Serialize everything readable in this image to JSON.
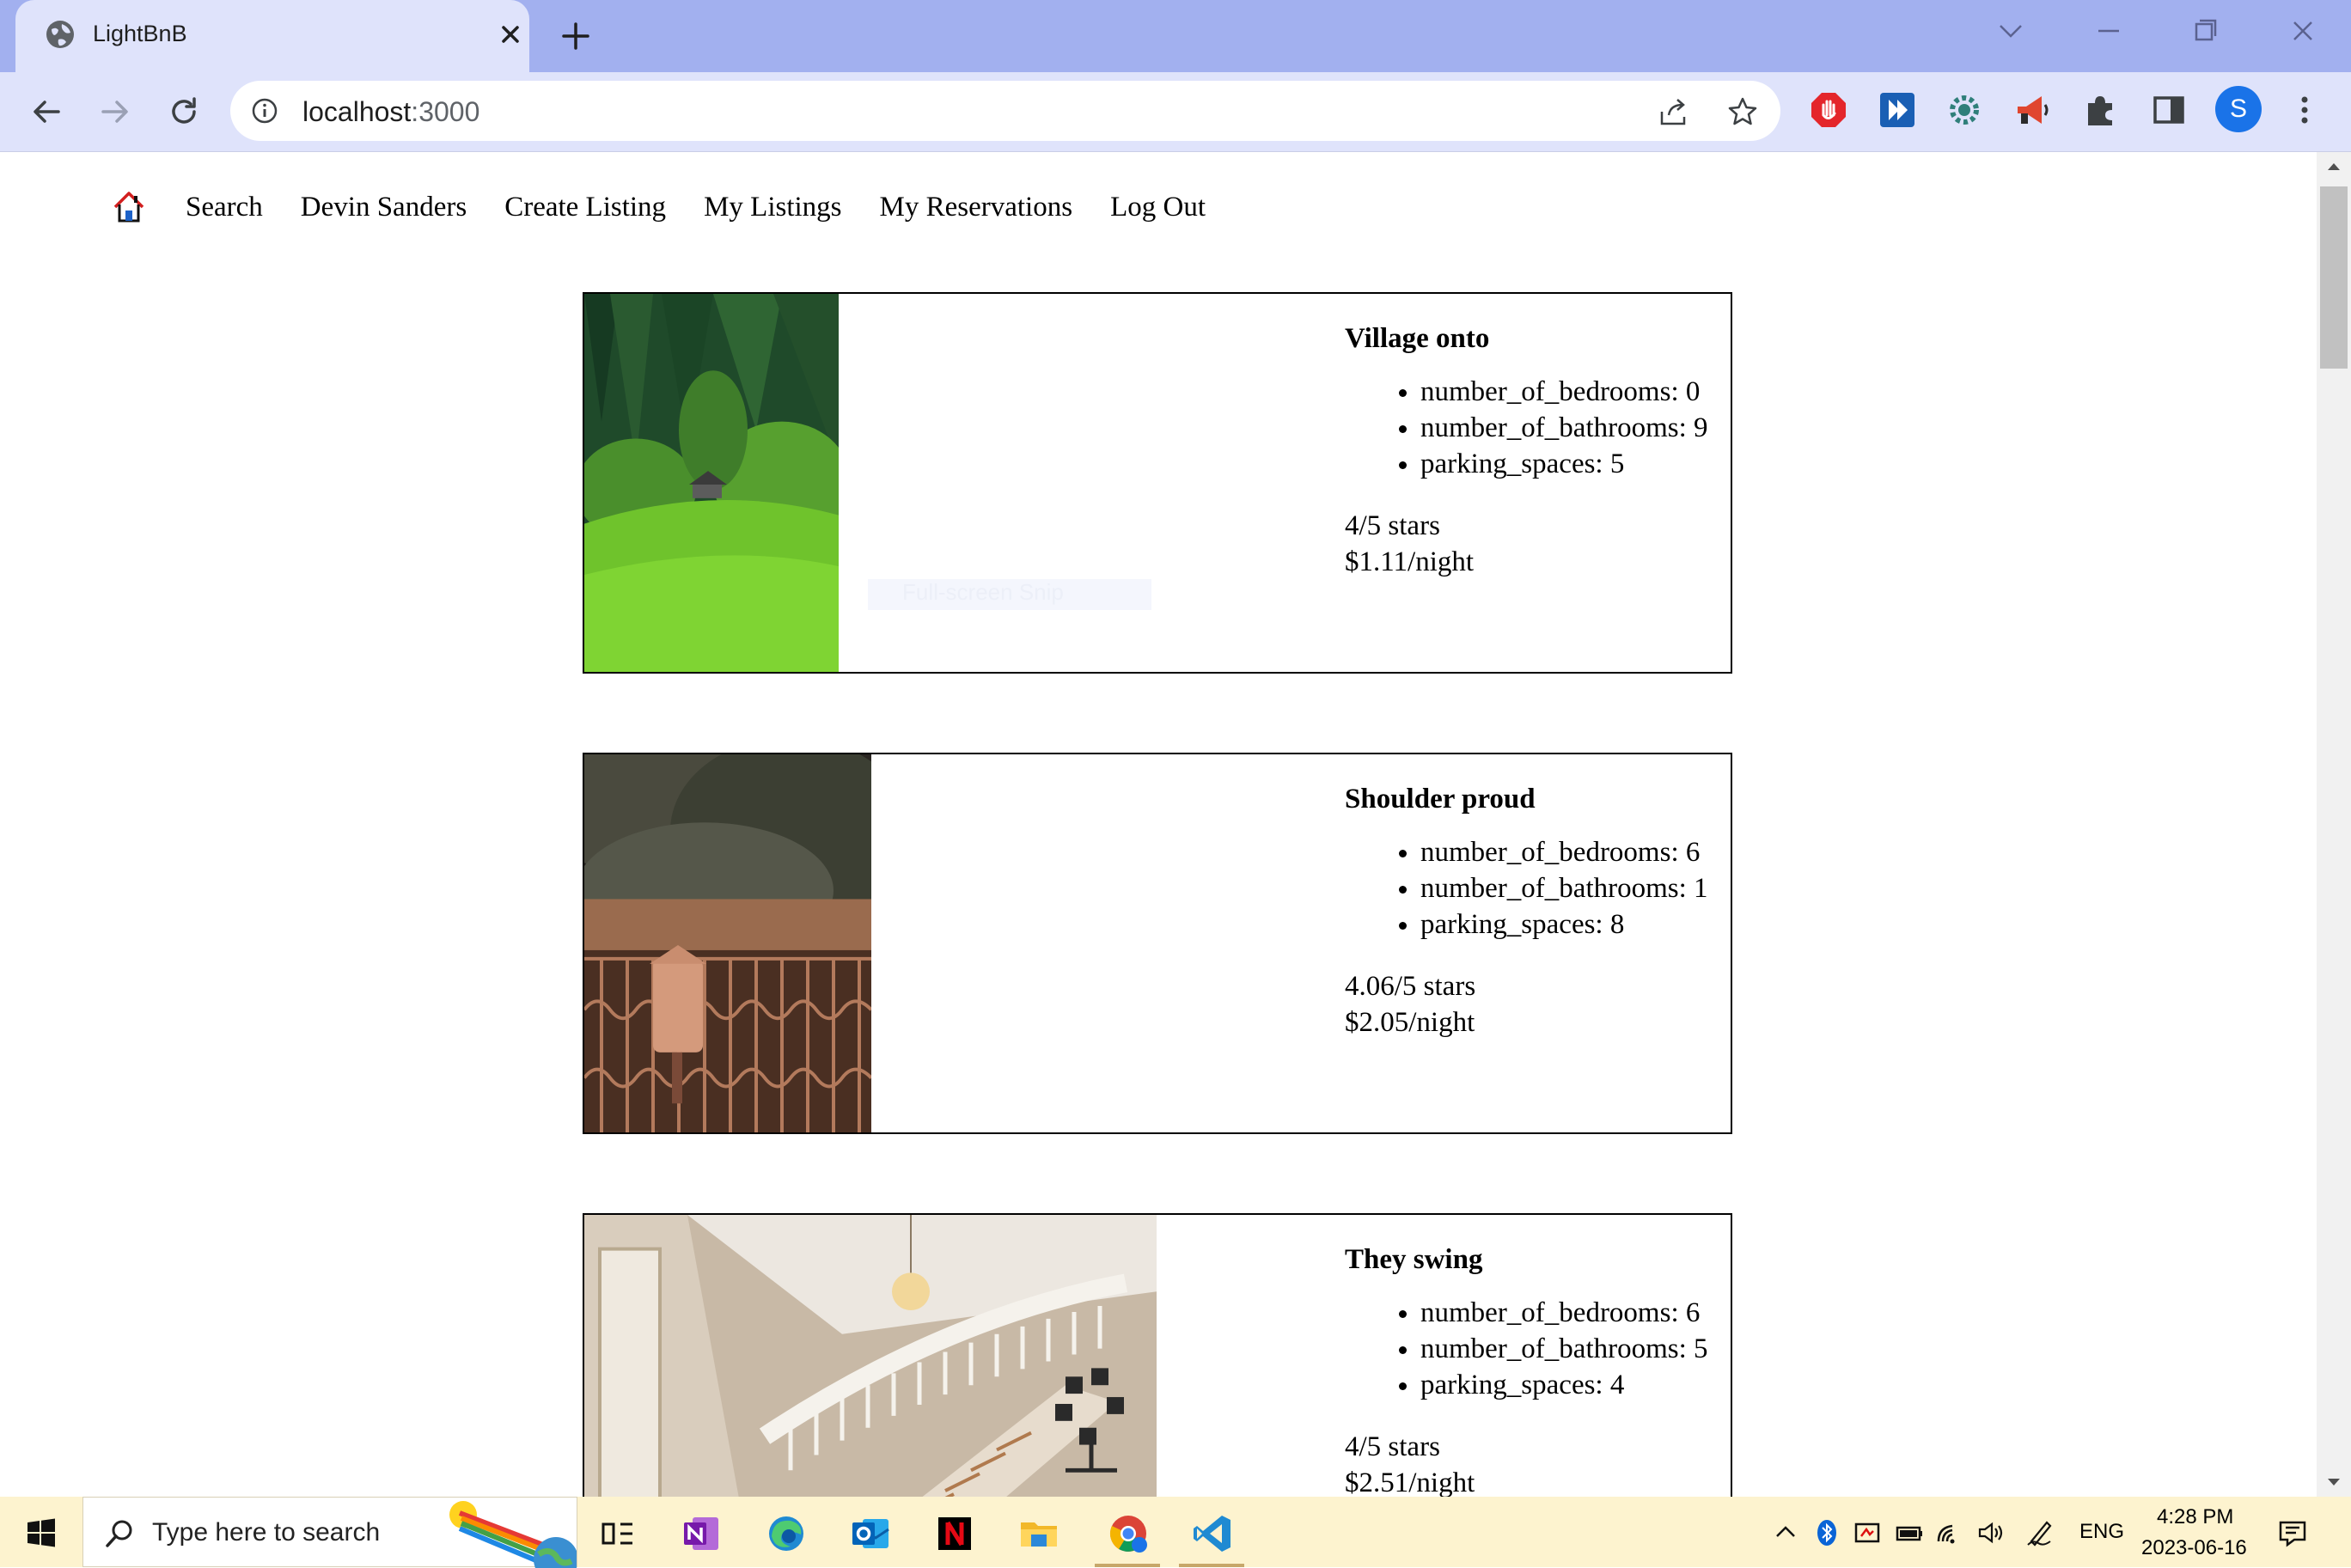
{
  "browser": {
    "tab_title": "LightBnB",
    "url_host": "localhost",
    "url_port": ":3000",
    "profile_initial": "S"
  },
  "site_nav": {
    "items": [
      "Search",
      "Devin Sanders",
      "Create Listing",
      "My Listings",
      "My Reservations",
      "Log Out"
    ]
  },
  "listings": [
    {
      "title": "Village onto",
      "details": [
        "number_of_bedrooms: 0",
        "number_of_bathrooms: 9",
        "parking_spaces: 5"
      ],
      "rating": "4/5 stars",
      "price": "$1.11/night",
      "photo": "forest-hillside-cabin"
    },
    {
      "title": "Shoulder proud",
      "details": [
        "number_of_bedrooms: 6",
        "number_of_bathrooms: 1",
        "parking_spaces: 8"
      ],
      "rating": "4.06/5 stars",
      "price": "$2.05/night",
      "photo": "mailbox-iron-fence"
    },
    {
      "title": "They swing",
      "details": [
        "number_of_bedrooms: 6",
        "number_of_bathrooms: 5",
        "parking_spaces: 4"
      ],
      "rating": "4/5 stars",
      "price": "$2.51/night",
      "photo": "spiral-staircase-foyer"
    }
  ],
  "overlay": {
    "snip_text": "Full-screen Snip"
  },
  "taskbar": {
    "search_placeholder": "Type here to search",
    "language": "ENG",
    "time": "4:28 PM",
    "date": "2023-06-16"
  },
  "colors": {
    "tabstrip": "#a2b0ef",
    "toolbar": "#dfe3fb",
    "avatar": "#1a73e8",
    "taskbar": "#fdf3cf"
  }
}
